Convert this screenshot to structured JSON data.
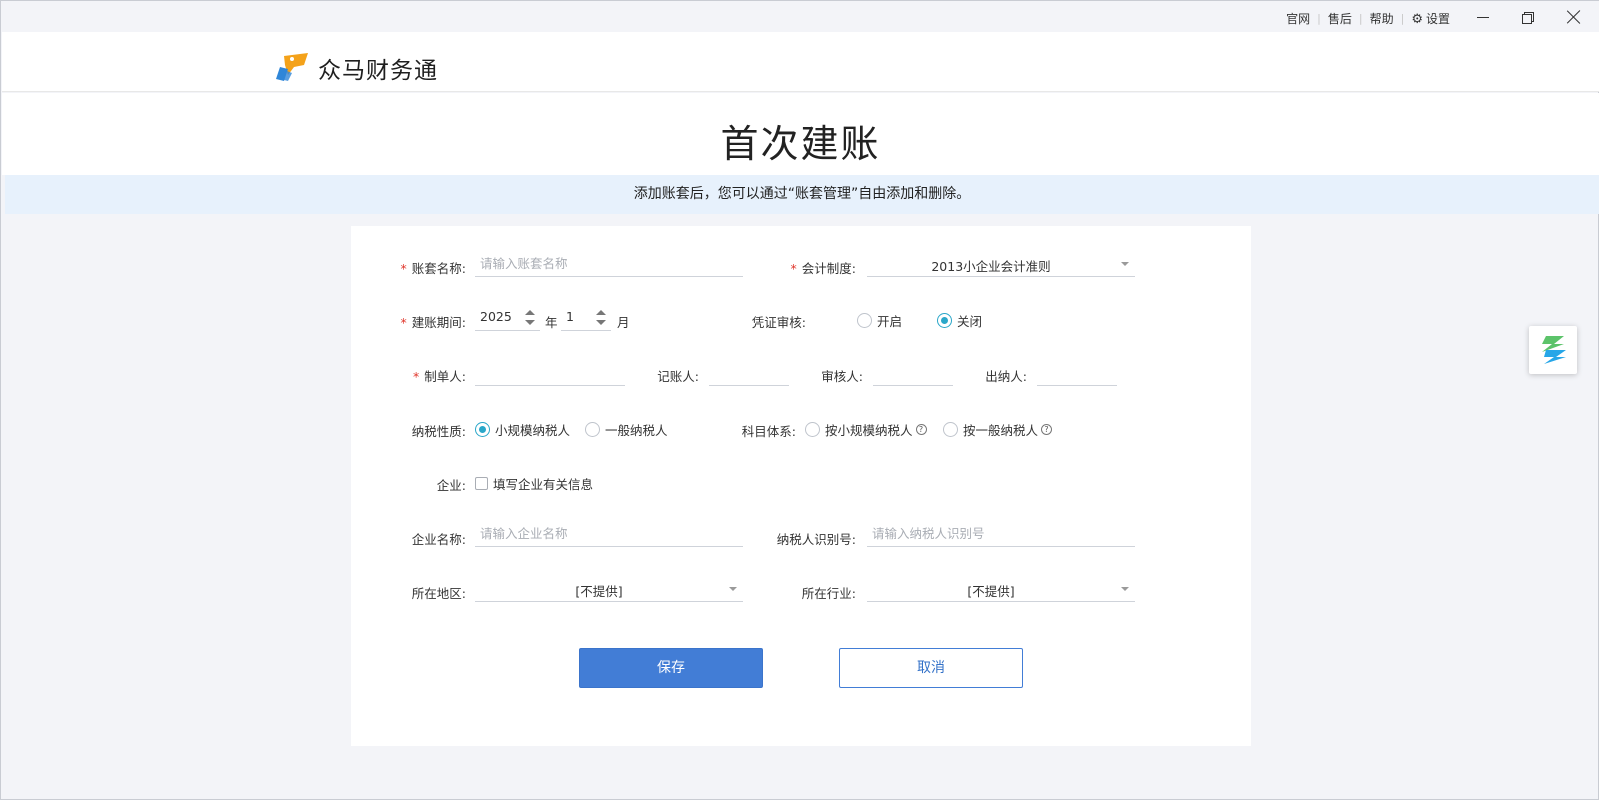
{
  "titlebar": {
    "links": [
      "官网",
      "售后",
      "帮助"
    ],
    "settings_label": "设置",
    "icons": [
      "gear-icon",
      "minimize-icon",
      "maximize-icon",
      "close-icon"
    ]
  },
  "header": {
    "app_name": "众马财务通",
    "logo_colors": {
      "orange": "#f4a21a",
      "blue": "#2f86d8"
    }
  },
  "page_title": "首次建账",
  "notice": "添加账套后，您可以通过“账套管理”自由添加和删除。",
  "form": {
    "account_name": {
      "label": "账套名称:",
      "placeholder": "请输入账套名称",
      "value": ""
    },
    "accounting_system": {
      "label": "会计制度:",
      "value": "2013小企业会计准则"
    },
    "period": {
      "label": "建账期间:",
      "year": "2025",
      "year_unit": "年",
      "month": "1",
      "month_unit": "月"
    },
    "voucher_review": {
      "label": "凭证审核:",
      "options": [
        "开启",
        "关闭"
      ],
      "selected": "关闭"
    },
    "people": {
      "maker": {
        "label": "制单人:",
        "value": ""
      },
      "bookkeeper": {
        "label": "记账人:",
        "value": ""
      },
      "reviewer": {
        "label": "审核人:",
        "value": ""
      },
      "cashier": {
        "label": "出纳人:",
        "value": ""
      }
    },
    "tax_type": {
      "label": "纳税性质:",
      "options": [
        "小规模纳税人",
        "一般纳税人"
      ],
      "selected": "小规模纳税人"
    },
    "subject_system": {
      "label": "科目体系:",
      "options": [
        "按小规模纳税人",
        "按一般纳税人"
      ],
      "selected": ""
    },
    "enterprise": {
      "label": "企业:",
      "checkbox_label": "填写企业有关信息",
      "checked": false
    },
    "company_name": {
      "label": "企业名称:",
      "placeholder": "请输入企业名称",
      "value": ""
    },
    "taxpayer_id": {
      "label": "纳税人识别号:",
      "placeholder": "请输入纳税人识别号",
      "value": ""
    },
    "region": {
      "label": "所在地区:",
      "value": "[不提供]"
    },
    "industry": {
      "label": "所在行业:",
      "value": "[不提供]"
    },
    "required_mark": "*"
  },
  "buttons": {
    "save": "保存",
    "cancel": "取消"
  },
  "colors": {
    "primary": "#427dd6",
    "radio_accent": "#2aa7c9",
    "required": "#e0362b",
    "notice_bg": "#e7f1fc"
  }
}
